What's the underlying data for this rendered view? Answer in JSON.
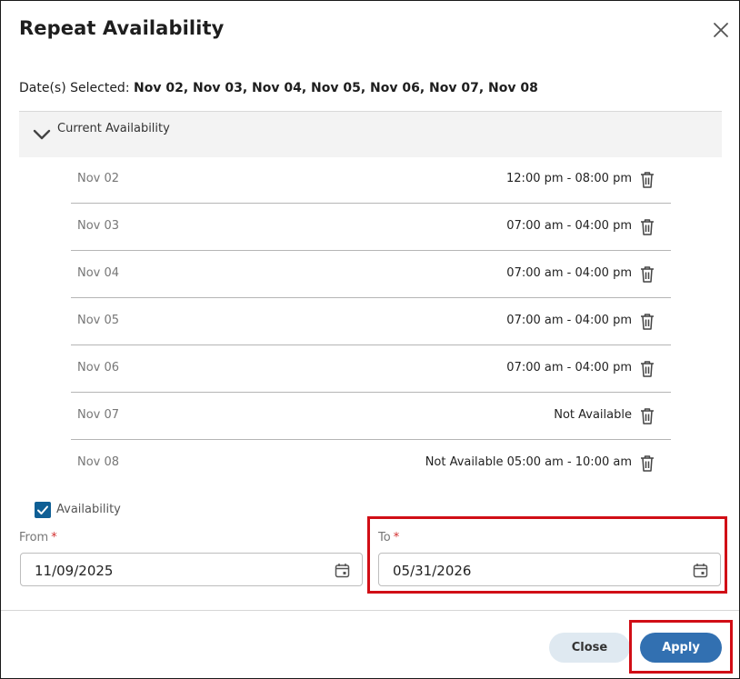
{
  "dialog": {
    "title": "Repeat Availability",
    "dates_selected_label": "Date(s) Selected:",
    "dates_selected_value": "Nov 02, Nov 03, Nov 04, Nov 05, Nov 06, Nov 07, Nov 08"
  },
  "accordion": {
    "label": "Current Availability",
    "expanded": true
  },
  "availability": [
    {
      "day": "Nov 02",
      "time": "12:00 pm - 08:00 pm"
    },
    {
      "day": "Nov 03",
      "time": "07:00 am - 04:00 pm"
    },
    {
      "day": "Nov 04",
      "time": "07:00 am - 04:00 pm"
    },
    {
      "day": "Nov 05",
      "time": "07:00 am - 04:00 pm"
    },
    {
      "day": "Nov 06",
      "time": "07:00 am - 04:00 pm"
    },
    {
      "day": "Nov 07",
      "time": "Not Available"
    },
    {
      "day": "Nov 08",
      "time": "Not Available 05:00 am - 10:00 am"
    }
  ],
  "checkbox": {
    "label": "Availability",
    "checked": true
  },
  "from": {
    "label": "From",
    "required_mark": "*",
    "value": "11/09/2025"
  },
  "to": {
    "label": "To",
    "required_mark": "*",
    "value": "05/31/2026"
  },
  "buttons": {
    "close": "Close",
    "apply": "Apply"
  },
  "colors": {
    "accent": "#3270b1",
    "checkbox": "#0f5f95",
    "highlight": "#d10e16",
    "close_button_bg": "#dfe9f1",
    "accordion_bg": "#f3f3f3",
    "required": "#d32f2f"
  },
  "icons": {
    "close": "close-icon",
    "chevron": "chevron-down-icon",
    "trash": "trash-icon",
    "calendar": "calendar-icon",
    "check": "check-icon"
  }
}
